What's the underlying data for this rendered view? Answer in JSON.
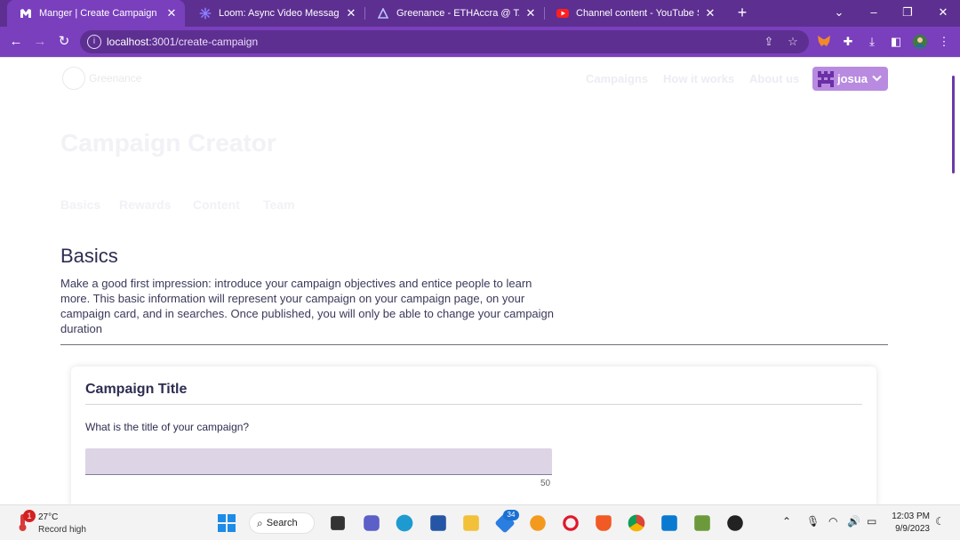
{
  "browser": {
    "tabs": [
      {
        "title": "Manger | Create Campaign",
        "active": true,
        "favicon": "greenance-m-icon"
      },
      {
        "title": "Loom: Async Video Messaging fo",
        "active": false,
        "favicon": "loom-icon"
      },
      {
        "title": "Greenance - ETHAccra @ TAIKAI",
        "active": false,
        "favicon": "taikai-icon"
      },
      {
        "title": "Channel content - YouTube Studi",
        "active": false,
        "favicon": "youtube-icon"
      }
    ],
    "url_host": "localhost",
    "url_path": ":3001/create-campaign"
  },
  "site": {
    "logo_text": "Greenance",
    "nav": [
      "Campaigns",
      "How it works",
      "About us"
    ],
    "user_name": "josua"
  },
  "creator": {
    "title": "Campaign Creator",
    "steps": [
      "Basics",
      "Rewards",
      "Content",
      "Team"
    ]
  },
  "basics": {
    "heading": "Basics",
    "description": "Make a good first impression: introduce your campaign objectives and entice people to learn more. This basic information will represent your campaign on your campaign page, on your campaign card, and in searches. Once published, you will only be able to change your campaign duration"
  },
  "campaign_title_card": {
    "title": "Campaign Title",
    "question": "What is the title of your campaign?",
    "input_value": "",
    "char_limit": "50"
  },
  "taskbar": {
    "temperature": "27°C",
    "weather_text": "Record high",
    "weather_badge": "1",
    "search_label": "Search",
    "app_badge": "34",
    "time": "12:03 PM",
    "date": "9/9/2023"
  },
  "colors": {
    "tab_strip": "#5d2f91",
    "toolbar": "#7a3fbd",
    "user_button": "#b88be0",
    "heading_text": "#2d2d52",
    "input_bg": "#ddd4e6"
  }
}
